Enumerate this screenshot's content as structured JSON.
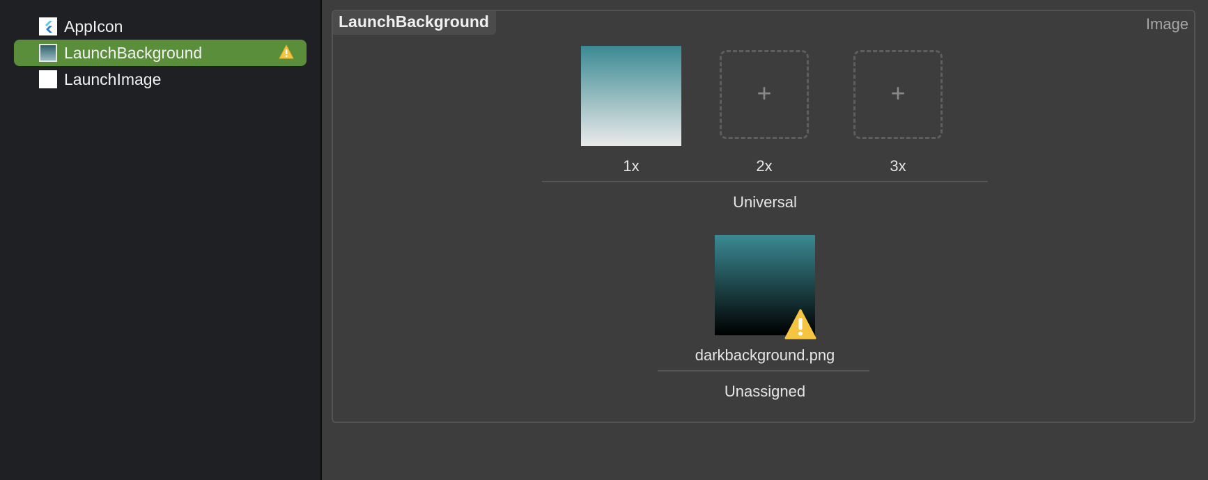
{
  "sidebar": {
    "items": [
      {
        "label": "AppIcon",
        "icon": "flutter-icon"
      },
      {
        "label": "LaunchBackground",
        "icon": "image-thumbnail",
        "selected": true,
        "warning": true
      },
      {
        "label": "LaunchImage",
        "icon": "blank-thumbnail"
      }
    ]
  },
  "panel": {
    "title": "LaunchBackground",
    "type_label": "Image",
    "universal": {
      "slots": [
        {
          "scale": "1x",
          "filled": true
        },
        {
          "scale": "2x",
          "filled": false,
          "plus": "+"
        },
        {
          "scale": "3x",
          "filled": false,
          "plus": "+"
        }
      ],
      "label": "Universal"
    },
    "unassigned": {
      "filename": "darkbackground.png",
      "label": "Unassigned",
      "warning": true
    }
  },
  "colors": {
    "selected_row": "#5a8e3b",
    "warning": "#f5c542",
    "sidebar_bg": "#1f2023",
    "main_bg": "#3d3d3e"
  }
}
